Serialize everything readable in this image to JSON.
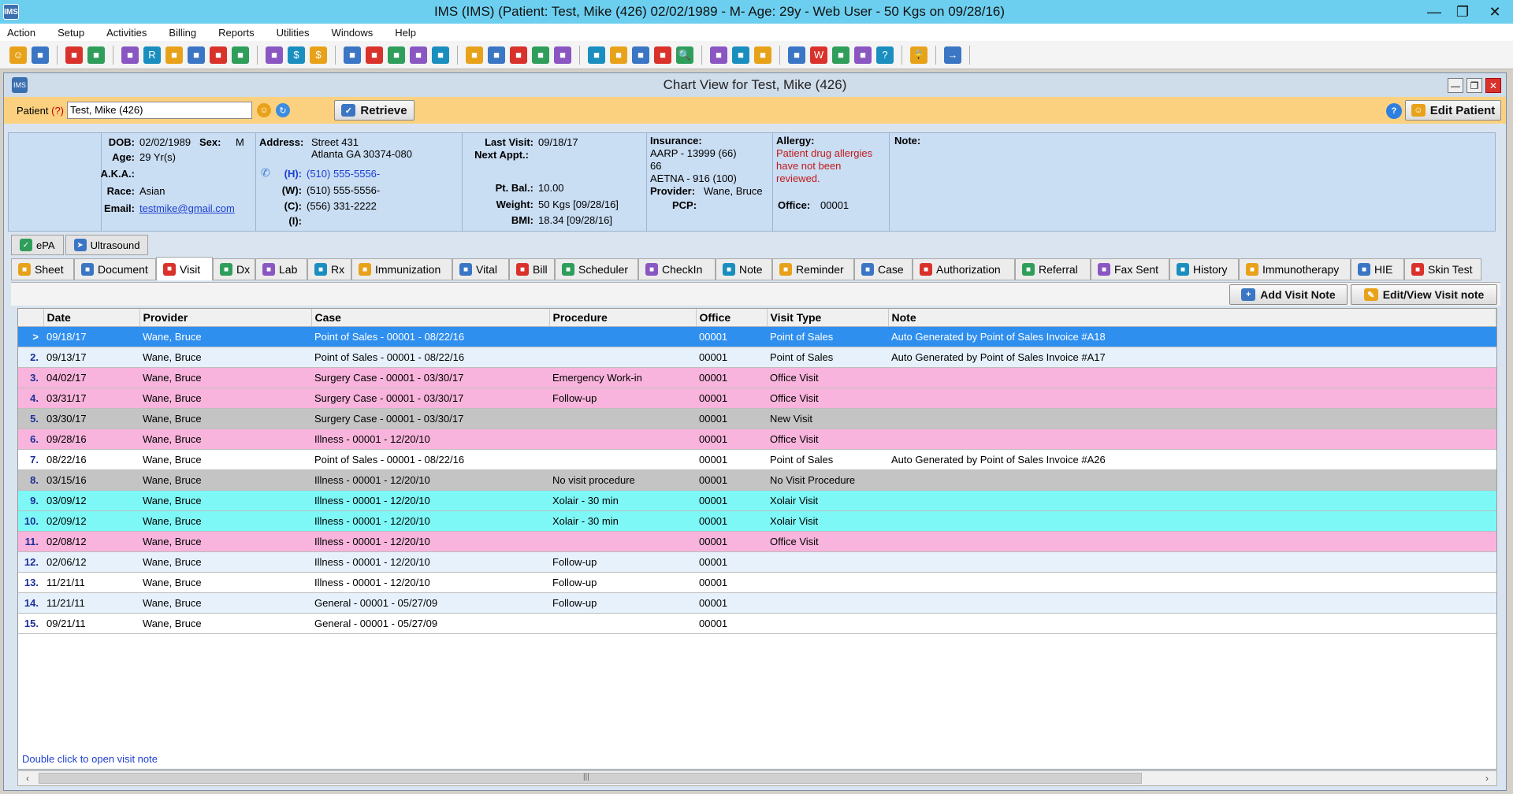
{
  "app": {
    "title": "IMS (IMS)    (Patient: Test, Mike  (426) 02/02/1989  - M-  Age: 29y  - Web User - 50 Kgs on 09/28/16)",
    "icon_label": "IMS"
  },
  "menu": [
    "Action",
    "Setup",
    "Activities",
    "Billing",
    "Reports",
    "Utilities",
    "Windows",
    "Help"
  ],
  "toolbar_icons": [
    "user-icon",
    "doctor-icon",
    "doctor2-icon",
    "folder-icon",
    "edit-icon",
    "rx-icon",
    "flask-icon",
    "shield-icon",
    "syringe-icon",
    "list-icon",
    "notes-icon",
    "dollar-icon",
    "dollar2-icon",
    "calc-icon",
    "money-icon",
    "money2-icon",
    "calendar-icon",
    "checkin-icon",
    "note-icon",
    "pen-icon",
    "box-icon",
    "box2-icon",
    "folder2-icon",
    "folder3-icon",
    "chart-icon",
    "case-icon",
    "print-icon",
    "search-icon",
    "tool-icon",
    "tree-icon",
    "import-icon",
    "sync-icon",
    "word-icon",
    "doc-icon",
    "page-icon",
    "help-icon",
    "lock-icon",
    "exit-icon"
  ],
  "chart": {
    "title": "Chart View for Test, Mike  (426)",
    "icon_label": "IMS"
  },
  "patient_bar": {
    "label": "Patient",
    "q": "(?)",
    "value": "Test, Mike  (426)",
    "retrieve": "Retrieve",
    "edit_patient": "Edit Patient"
  },
  "info": {
    "dob_label": "DOB:",
    "dob": "02/02/1989",
    "sex_label": "Sex:",
    "sex": "M",
    "age_label": "Age:",
    "age": "29 Yr(s)",
    "aka_label": "A.K.A.:",
    "race_label": "Race:",
    "race": "Asian",
    "email_label": "Email:",
    "email": "testmike@gmail.com",
    "address_label": "Address:",
    "address1": "Street 431",
    "address2": "Atlanta  GA  30374-080",
    "h_label": "(H):",
    "h_phone": "(510) 555-5556-",
    "w_label": "(W):",
    "w_phone": "(510) 555-5556-",
    "c_label": "(C):",
    "c_phone": "(556) 331-2222",
    "i_label": "(I):",
    "last_visit_label": "Last Visit:",
    "last_visit": "09/18/17",
    "next_appt_label": "Next Appt.:",
    "pt_bal_label": "Pt. Bal.:",
    "pt_bal": "10.00",
    "weight_label": "Weight:",
    "weight": "50 Kgs [09/28/16]",
    "bmi_label": "BMI:",
    "bmi": "18.34 [09/28/16]",
    "insurance_label": "Insurance:",
    "ins1": "AARP - 13999   (66)",
    "ins1b": "66",
    "ins2": "AETNA - 916   (100)",
    "provider_label": "Provider:",
    "provider": "Wane, Bruce",
    "pcp_label": "PCP:",
    "allergy_label": "Allergy:",
    "allergy_text1": "Patient drug allergies",
    "allergy_text2": "have not been",
    "allergy_text3": "reviewed.",
    "office_label": "Office:",
    "office": "00001",
    "note_label": "Note:"
  },
  "tabs_top": [
    {
      "label": "ePA",
      "icon": "shield-icon"
    },
    {
      "label": "Ultrasound",
      "icon": "probe-icon"
    }
  ],
  "tabs_main": [
    {
      "label": "Sheet",
      "icon": "sheet-icon",
      "w": 80
    },
    {
      "label": "Document",
      "icon": "document-icon",
      "w": 104
    },
    {
      "label": "Visit",
      "icon": "visit-icon",
      "w": 72,
      "active": true
    },
    {
      "label": "Dx",
      "icon": "dx-icon",
      "w": 54
    },
    {
      "label": "Lab",
      "icon": "flask-icon",
      "w": 66
    },
    {
      "label": "Rx",
      "icon": "rx-icon",
      "w": 56
    },
    {
      "label": "Immunization",
      "icon": "syringe-icon",
      "w": 128
    },
    {
      "label": "Vital",
      "icon": "vital-icon",
      "w": 72
    },
    {
      "label": "Bill",
      "icon": "dollar-icon",
      "w": 58
    },
    {
      "label": "Scheduler",
      "icon": "calendar-icon",
      "w": 106
    },
    {
      "label": "CheckIn",
      "icon": "checkin-icon",
      "w": 98
    },
    {
      "label": "Note",
      "icon": "note-icon",
      "w": 72
    },
    {
      "label": "Reminder",
      "icon": "reminder-icon",
      "w": 104
    },
    {
      "label": "Case",
      "icon": "case-icon",
      "w": 74
    },
    {
      "label": "Authorization",
      "icon": "authorization-icon",
      "w": 130
    },
    {
      "label": "Referral",
      "icon": "referral-icon",
      "w": 96
    },
    {
      "label": "Fax Sent",
      "icon": "fax-icon",
      "w": 100
    },
    {
      "label": "History",
      "icon": "history-icon",
      "w": 88
    },
    {
      "label": "Immunotherapy",
      "icon": "immuno-icon",
      "w": 142
    },
    {
      "label": "HIE",
      "icon": "hie-icon",
      "w": 68
    },
    {
      "label": "Skin Test",
      "icon": "skin-icon",
      "w": 98
    }
  ],
  "actions": {
    "add_visit_note": "Add Visit Note",
    "edit_view_visit_note": "Edit/View Visit note"
  },
  "grid": {
    "columns": [
      "",
      "Date",
      "Provider",
      "Case",
      "Procedure",
      "Office",
      "Visit Type",
      "Note"
    ],
    "rows": [
      {
        "n": ">",
        "date": "09/18/17",
        "provider": "Wane, Bruce",
        "case": "Point of Sales  -  00001 - 08/22/16",
        "procedure": "",
        "office": "00001",
        "visit_type": "Point of Sales",
        "note": "Auto Generated by Point of Sales Invoice #A18",
        "bg": "#2f8fef",
        "sel": true
      },
      {
        "n": "2.",
        "date": "09/13/17",
        "provider": "Wane, Bruce",
        "case": "Point of Sales  -  00001 - 08/22/16",
        "procedure": "",
        "office": "00001",
        "visit_type": "Point of Sales",
        "note": "Auto Generated by Point of Sales Invoice #A17",
        "bg": "#e6f1fc"
      },
      {
        "n": "3.",
        "date": "04/02/17",
        "provider": "Wane, Bruce",
        "case": "Surgery Case  -  00001 - 03/30/17",
        "procedure": "Emergency Work-in",
        "office": "00001",
        "visit_type": "Office Visit",
        "note": "",
        "bg": "#f8b4dc"
      },
      {
        "n": "4.",
        "date": "03/31/17",
        "provider": "Wane, Bruce",
        "case": "Surgery Case  -  00001 - 03/30/17",
        "procedure": "Follow-up",
        "office": "00001",
        "visit_type": "Office Visit",
        "note": "",
        "bg": "#f8b4dc"
      },
      {
        "n": "5.",
        "date": "03/30/17",
        "provider": "Wane, Bruce",
        "case": "Surgery Case  -  00001 - 03/30/17",
        "procedure": "",
        "office": "00001",
        "visit_type": "New Visit",
        "note": "",
        "bg": "#c4c4c4"
      },
      {
        "n": "6.",
        "date": "09/28/16",
        "provider": "Wane, Bruce",
        "case": "Illness  -  00001 - 12/20/10",
        "procedure": "",
        "office": "00001",
        "visit_type": "Office Visit",
        "note": "",
        "bg": "#f8b4dc"
      },
      {
        "n": "7.",
        "date": "08/22/16",
        "provider": "Wane, Bruce",
        "case": "Point of Sales  -  00001 - 08/22/16",
        "procedure": "",
        "office": "00001",
        "visit_type": "Point of Sales",
        "note": "Auto Generated by Point of Sales Invoice #A26",
        "bg": "#ffffff"
      },
      {
        "n": "8.",
        "date": "03/15/16",
        "provider": "Wane, Bruce",
        "case": "Illness  -  00001 - 12/20/10",
        "procedure": "No visit procedure",
        "office": "00001",
        "visit_type": "No Visit Procedure",
        "note": "",
        "bg": "#c4c4c4"
      },
      {
        "n": "9.",
        "date": "03/09/12",
        "provider": "Wane, Bruce",
        "case": "Illness  -  00001 - 12/20/10",
        "procedure": "Xolair - 30 min",
        "office": "00001",
        "visit_type": "Xolair Visit",
        "note": "",
        "bg": "#7ef7f7"
      },
      {
        "n": "10.",
        "date": "02/09/12",
        "provider": "Wane, Bruce",
        "case": "Illness  -  00001 - 12/20/10",
        "procedure": "Xolair - 30 min",
        "office": "00001",
        "visit_type": "Xolair Visit",
        "note": "",
        "bg": "#7ef7f7"
      },
      {
        "n": "11.",
        "date": "02/08/12",
        "provider": "Wane, Bruce",
        "case": "Illness  -  00001 - 12/20/10",
        "procedure": "",
        "office": "00001",
        "visit_type": "Office Visit",
        "note": "",
        "bg": "#f8b4dc"
      },
      {
        "n": "12.",
        "date": "02/06/12",
        "provider": "Wane, Bruce",
        "case": "Illness  -  00001 - 12/20/10",
        "procedure": "Follow-up",
        "office": "00001",
        "visit_type": "",
        "note": "",
        "bg": "#e6f1fc"
      },
      {
        "n": "13.",
        "date": "11/21/11",
        "provider": "Wane, Bruce",
        "case": "Illness  -  00001 - 12/20/10",
        "procedure": "Follow-up",
        "office": "00001",
        "visit_type": "",
        "note": "",
        "bg": "#ffffff"
      },
      {
        "n": "14.",
        "date": "11/21/11",
        "provider": "Wane, Bruce",
        "case": "General  -  00001 - 05/27/09",
        "procedure": "Follow-up",
        "office": "00001",
        "visit_type": "",
        "note": "",
        "bg": "#e6f1fc"
      },
      {
        "n": "15.",
        "date": "09/21/11",
        "provider": "Wane, Bruce",
        "case": "General  -  00001 - 05/27/09",
        "procedure": "",
        "office": "00001",
        "visit_type": "",
        "note": "",
        "bg": "#ffffff"
      }
    ]
  },
  "footer_hint": "Double click to open visit note",
  "colors": {
    "titlebar": "#6dcfef",
    "patient_bar": "#fbd17f",
    "selected": "#2f8fef",
    "pink": "#f8b4dc",
    "cyan": "#7ef7f7",
    "gray": "#c4c4c4"
  }
}
